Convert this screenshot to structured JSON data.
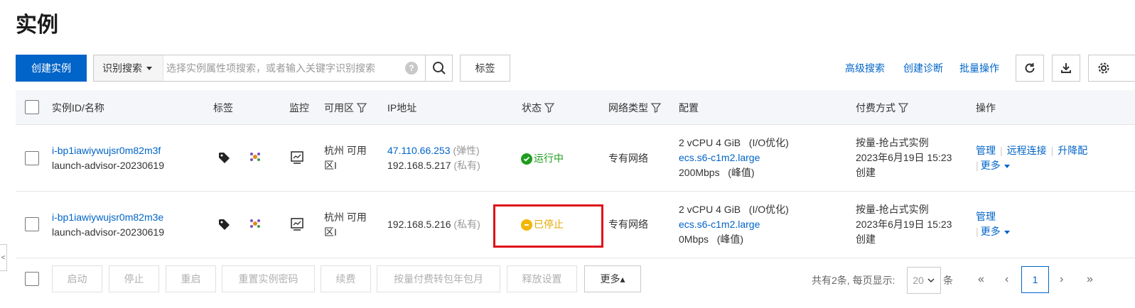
{
  "page": {
    "title": "实例"
  },
  "toolbar": {
    "create_label": "创建实例",
    "search_type_label": "识别搜索",
    "search_placeholder": "选择实例属性项搜索，或者输入关键字识别搜索",
    "help_label": "?",
    "tag_label": "标签",
    "advanced_search_label": "高级搜索",
    "create_diagnosis_label": "创建诊断",
    "batch_ops_label": "批量操作"
  },
  "table": {
    "headers": {
      "id_name": "实例ID/名称",
      "tags": "标签",
      "monitor": "监控",
      "zone": "可用区",
      "ip": "IP地址",
      "status": "状态",
      "network": "网络类型",
      "config": "配置",
      "billing": "付费方式",
      "actions": "操作"
    },
    "rows": [
      {
        "id": "i-bp1iawiywujsr0m82m3f",
        "name": "launch-advisor-20230619",
        "zone_line1": "杭州 可用",
        "zone_line2": "区I",
        "ip_public": "47.110.66.253",
        "ip_public_tag": "(弹性)",
        "ip_private": "192.168.5.217",
        "ip_private_tag": "(私有)",
        "status": "运行中",
        "status_color": "#1e9e1e",
        "network": "专有网络",
        "config_line1": "2 vCPU 4 GiB   (I/O优化)",
        "config_type": "ecs.s6-c1m2.large",
        "config_bandwidth": "200Mbps   (峰值)",
        "billing_line1": "按量-抢占式实例",
        "billing_line2": "2023年6月19日 15:23",
        "billing_line3": "创建",
        "action_manage": "管理",
        "action_remote": "远程连接",
        "action_upgrade": "升降配",
        "action_more": "更多"
      },
      {
        "id": "i-bp1iawiywujsr0m82m3e",
        "name": "launch-advisor-20230619",
        "zone_line1": "杭州 可用",
        "zone_line2": "区I",
        "ip_private": "192.168.5.216",
        "ip_private_tag": "(私有)",
        "status": "已停止",
        "status_color": "#e6a800",
        "network": "专有网络",
        "config_line1": "2 vCPU 4 GiB   (I/O优化)",
        "config_type": "ecs.s6-c1m2.large",
        "config_bandwidth": "0Mbps   (峰值)",
        "billing_line1": "按量-抢占式实例",
        "billing_line2": "2023年6月19日 15:23",
        "billing_line3": "创建",
        "action_manage": "管理",
        "action_more": "更多"
      }
    ]
  },
  "footer": {
    "buttons": [
      "启动",
      "停止",
      "重启",
      "重置实例密码",
      "续费",
      "按量付费转包年包月",
      "释放设置"
    ],
    "more_label": "更多▴",
    "total_text": "共有2条, 每页显示:",
    "page_size": "20",
    "unit": "条",
    "first": "«",
    "prev": "‹",
    "current_page": "1",
    "next": "›",
    "last": "»"
  },
  "side_tab_label": "<"
}
